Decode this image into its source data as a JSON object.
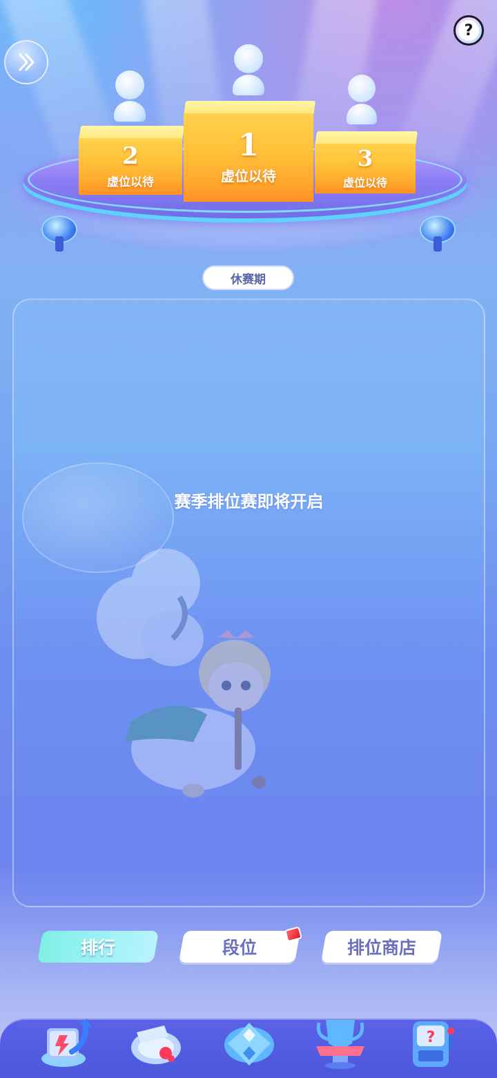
{
  "podium": {
    "first": {
      "rank": "1",
      "label": "虚位以待"
    },
    "second": {
      "rank": "2",
      "label": "虚位以待"
    },
    "third": {
      "rank": "3",
      "label": "虚位以待"
    }
  },
  "season_status": "休赛期",
  "panel": {
    "empty_message": "赛季排位赛即将开启"
  },
  "tabs": [
    {
      "label": "排行",
      "active": true
    },
    {
      "label": "段位",
      "active": false,
      "badge": "red-notification"
    },
    {
      "label": "排位商店",
      "active": false
    }
  ],
  "bottom_nav": [
    {
      "icon": "ranking-arrow-icon"
    },
    {
      "icon": "whistle-icon"
    },
    {
      "icon": "gamepad-icon"
    },
    {
      "icon": "trophy-icon"
    },
    {
      "icon": "mystery-machine-icon"
    }
  ],
  "colors": {
    "accent_cyan": "#7ff0e6",
    "tab_text": "#6b6fc0",
    "podium_gold": "#ffc23a",
    "nav_bg": "#5a62e6"
  }
}
